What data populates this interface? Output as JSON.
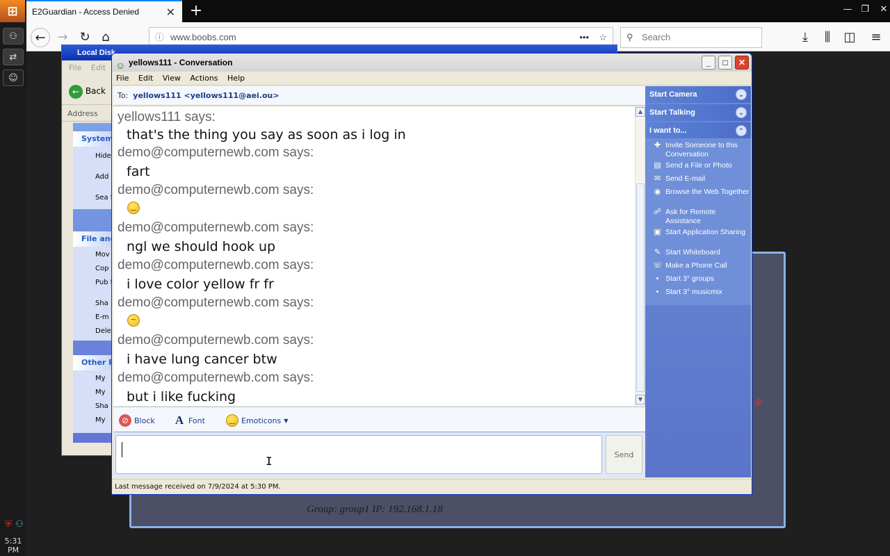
{
  "browser": {
    "tab_title": "E2Guardian - Access Denied",
    "url": "www.boobs.com",
    "search_placeholder": "Search"
  },
  "taskbar": {
    "clock": "5:31 PM"
  },
  "page": {
    "info_text": "Group: group1   IP: 192.168.1.18"
  },
  "explorer": {
    "title": "Local Disk",
    "menu": [
      "File",
      "Edit"
    ],
    "back_label": "Back",
    "address_label": "Address",
    "panels": [
      {
        "title": "System",
        "links": [
          "Hide this",
          "Add prog",
          "Sea fold"
        ]
      },
      {
        "title": "File and",
        "links": [
          "Mov",
          "Cop",
          "Pub the",
          "Sha",
          "E-m",
          "Dele"
        ]
      },
      {
        "title": "Other P",
        "links": [
          "My",
          "My",
          "Sha",
          "My"
        ]
      }
    ]
  },
  "conversation": {
    "window_title": "yellows111 - Conversation",
    "menu": [
      "File",
      "Edit",
      "View",
      "Actions",
      "Help"
    ],
    "to_label": "To:",
    "to_value": "yellows111 <yellows111@aei.ou>",
    "messages": [
      {
        "sender": "yellows111 says:",
        "text": "that's the thing you say as soon as i log in"
      },
      {
        "sender": "demo@computernewb.com says:",
        "text": "fart"
      },
      {
        "sender": "demo@computernewb.com says:",
        "emoticon": "smile"
      },
      {
        "sender": "demo@computernewb.com says:",
        "text": "ngl we should hook up"
      },
      {
        "sender": "demo@computernewb.com says:",
        "text": "i love color yellow fr fr"
      },
      {
        "sender": "demo@computernewb.com says:",
        "emoticon": "confused"
      },
      {
        "sender": "demo@computernewb.com says:",
        "text": "i have lung cancer btw"
      },
      {
        "sender": "demo@computernewb.com says:",
        "text": "but i like fucking"
      }
    ],
    "toolbar": {
      "block_label": "Block",
      "font_label": "Font",
      "emoticons_label": "Emoticons"
    },
    "input_value": "",
    "send_label": "Send",
    "status": "Last message received on 7/9/2024 at 5:30 PM.",
    "task_pane": {
      "start_camera": "Start Camera",
      "start_talking": "Start Talking",
      "i_want_to": "I want to...",
      "links": [
        {
          "label": "Invite Someone to this Conversation",
          "icon": "invite-icon"
        },
        {
          "label": "Send a File or Photo",
          "icon": "file-icon"
        },
        {
          "label": "Send E-mail",
          "icon": "email-icon"
        },
        {
          "label": "Browse the Web Together",
          "icon": "web-icon"
        },
        {
          "label": "Ask for Remote Assistance",
          "icon": "assist-icon"
        },
        {
          "label": "Start Application Sharing",
          "icon": "share-icon"
        },
        {
          "label": "Start Whiteboard",
          "icon": "whiteboard-icon"
        },
        {
          "label": "Make a Phone Call",
          "icon": "phone-icon"
        },
        {
          "label": "Start 3° groups",
          "icon": "bullet-icon"
        },
        {
          "label": "Start 3° musicmix",
          "icon": "bullet-icon"
        }
      ]
    }
  }
}
